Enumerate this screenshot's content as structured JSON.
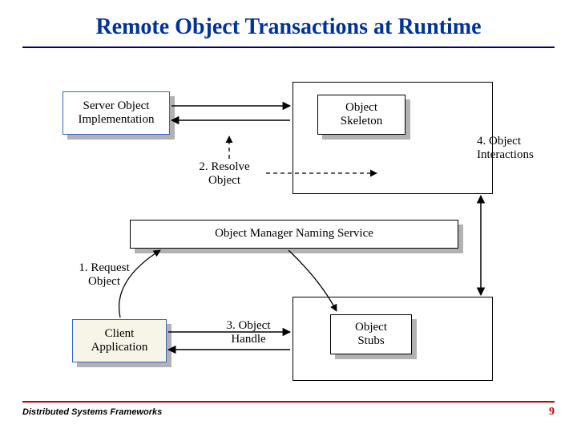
{
  "title": "Remote Object Transactions at Runtime",
  "boxes": {
    "server_impl": "Server Object\nImplementation",
    "skeleton": "Object\nSkeleton",
    "manager": "Object Manager Naming Service",
    "client": "Client\nApplication",
    "stubs": "Object\nStubs"
  },
  "labels": {
    "step1": "1. Request\nObject",
    "step2": "2. Resolve\nObject",
    "step3": "3. Object\nHandle",
    "step4": "4. Object\nInteractions"
  },
  "footer": {
    "left": "Distributed Systems Frameworks",
    "page": "9"
  }
}
